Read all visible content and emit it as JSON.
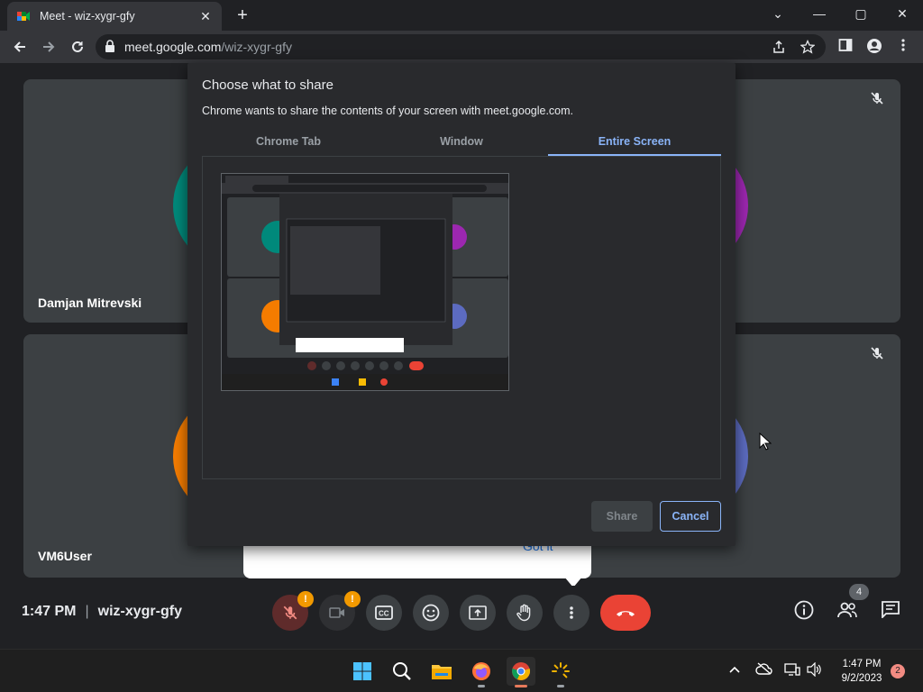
{
  "browser": {
    "tab_title": "Meet - wiz-xygr-gfy",
    "tab_close": "✕",
    "new_tab": "+",
    "url_host": "meet.google.com",
    "url_path": "/wiz-xygr-gfy",
    "window_controls": {
      "minimize": "—",
      "maximize": "▢",
      "close": "✕",
      "tab_list": "⌄"
    }
  },
  "dialog": {
    "title": "Choose what to share",
    "subtitle": "Chrome wants to share the contents of your screen with meet.google.com.",
    "tabs": [
      {
        "label": "Chrome Tab",
        "active": false
      },
      {
        "label": "Window",
        "active": false
      },
      {
        "label": "Entire Screen",
        "active": true
      }
    ],
    "share_label": "Share",
    "cancel_label": "Cancel"
  },
  "tiles": [
    {
      "name": "Damjan Mitrevski",
      "avatar_color": "#00897b",
      "accent_color": "#9c27b0"
    },
    {
      "name": "VM6User",
      "avatar_color": "#f57c00",
      "accent_color": "#5c6bc0"
    }
  ],
  "tooltip": {
    "link": "Got it"
  },
  "meeting": {
    "time": "1:47 PM",
    "code": "wiz-xygr-gfy",
    "participants_count": "4"
  },
  "taskbar": {
    "time": "1:47 PM",
    "date": "9/2/2023",
    "notification_count": "2"
  },
  "colors": {
    "accent_blue": "#8ab4f8",
    "end_call_red": "#ea4335",
    "warning_orange": "#f29900"
  }
}
